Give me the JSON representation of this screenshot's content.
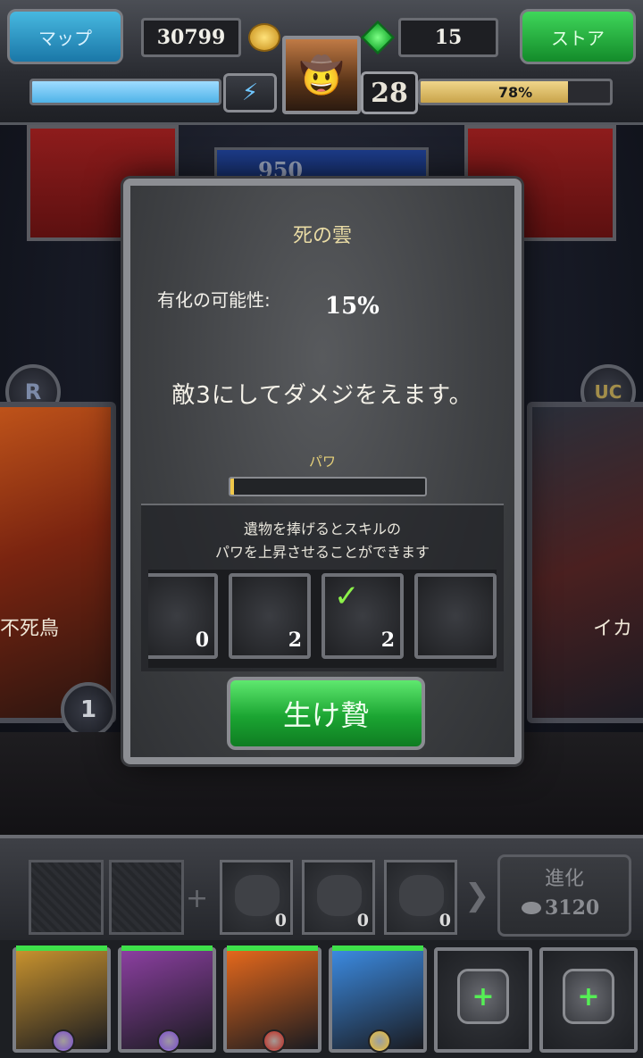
{
  "topbar": {
    "map_label": "マップ",
    "coins": "30799",
    "coin_icon": "gold-coins-icon",
    "gems": "15",
    "gem_icon": "green-gem-icon",
    "store_label": "ストア",
    "energy_fraction": 1.0,
    "energy_icon": "lightning-bolt-icon",
    "level": "28",
    "xp_percent": 78,
    "xp_text": "78%"
  },
  "background": {
    "hp_text": "950",
    "left_rarity": "R",
    "right_rarity": "UC",
    "left_name": "不死鳥",
    "right_name": "イカ",
    "left_level": "1"
  },
  "dialog": {
    "title": "死の雲",
    "chance_label": "有化の可能性:",
    "chance_value": "15%",
    "description": "敵3にしてダメジをえます。",
    "power_label": "パワ",
    "power_fraction": 0.02,
    "relic_hint_line1": "遺物を捧げるとスキルの",
    "relic_hint_line2": "パワを上昇させることができます",
    "relics": [
      {
        "name": "red-dragon-relic",
        "count": "0",
        "checked": false,
        "color": "#c23a14"
      },
      {
        "name": "blood-potion-relic",
        "count": "2",
        "checked": false,
        "color": "#d25a1a"
      },
      {
        "name": "bone-claw-relic",
        "count": "2",
        "checked": true,
        "color": "#7b7e84"
      },
      {
        "name": "treasure-chest-relic",
        "count": "",
        "checked": false,
        "color": "#3c7fc0"
      }
    ],
    "sacrifice_label": "生け贄"
  },
  "tray": {
    "evolve_label": "進化",
    "evolve_cost": "3120",
    "materials": [
      {
        "name": "bat-wing-material",
        "count": "0"
      },
      {
        "name": "gargoyle-material",
        "count": "0"
      },
      {
        "name": "skull-helm-material",
        "count": "0"
      }
    ]
  },
  "party": [
    {
      "name": "golden-horned-warrior",
      "color": "#c7922e",
      "orb": "#7a4ad0",
      "locked": false
    },
    {
      "name": "masked-sorceress",
      "color": "#8b3fa0",
      "orb": "#7a4ad0",
      "locked": false
    },
    {
      "name": "fire-phoenix",
      "color": "#e4681c",
      "orb": "#c0241a",
      "locked": false
    },
    {
      "name": "blue-griffin",
      "color": "#3b8ae0",
      "orb": "#f0c030",
      "locked": false
    },
    {
      "name": "locked-slot",
      "color": "#2a2c31",
      "orb": "",
      "locked": true
    },
    {
      "name": "locked-slot",
      "color": "#2a2c31",
      "orb": "",
      "locked": true
    }
  ]
}
